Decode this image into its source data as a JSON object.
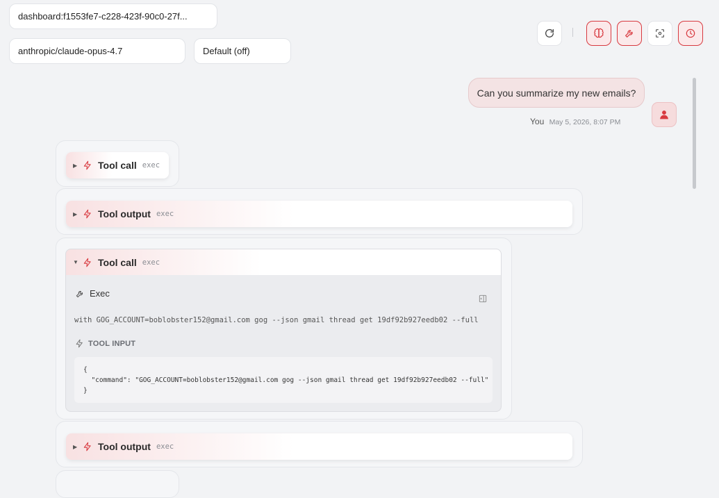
{
  "session": {
    "dashboard_id": "dashboard:f1553fe7-c228-423f-90c0-27f...",
    "model": "anthropic/claude-opus-4.7",
    "thinking": "Default (off)"
  },
  "toolbar": {
    "refresh_icon": "refresh-icon",
    "brain_icon": "brain-icon",
    "wrench_icon": "wrench-icon",
    "focus_icon": "focus-icon",
    "clock_icon": "clock-icon",
    "accent_color": "#d8393f"
  },
  "user_message": {
    "text": "Can you summarize my new emails?",
    "author": "You",
    "timestamp": "May 5, 2026, 8:07 PM"
  },
  "tool_events": [
    {
      "title": "Tool call",
      "tool": "exec",
      "expanded": false
    },
    {
      "title": "Tool output",
      "tool": "exec",
      "expanded": false
    },
    {
      "title": "Tool call",
      "tool": "exec",
      "expanded": true
    },
    {
      "title": "Tool output",
      "tool": "exec",
      "expanded": false
    }
  ],
  "exec_detail": {
    "title": "Exec",
    "command": "with GOG_ACCOUNT=boblobster152@gmail.com gog --json gmail thread get 19df92b927eedb02 --full",
    "input_label": "TOOL INPUT",
    "input_open": "{",
    "input_line": "  \"command\": \"GOG_ACCOUNT=boblobster152@gmail.com gog --json gmail thread get 19df92b927eedb02 --full\"",
    "input_close": "}"
  }
}
